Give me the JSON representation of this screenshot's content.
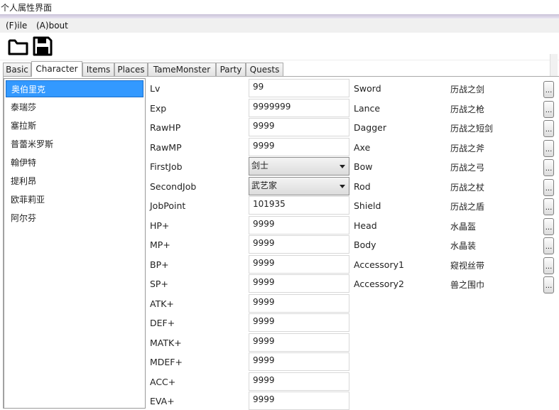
{
  "window": {
    "title": "个人属性界面"
  },
  "menu": {
    "file": "(F)ile",
    "about": "(A)bout"
  },
  "toolbar": {
    "open_icon": "folder-open-icon",
    "save_icon": "floppy-save-icon"
  },
  "tabs": [
    {
      "label": "Basic"
    },
    {
      "label": "Character"
    },
    {
      "label": "Items"
    },
    {
      "label": "Places"
    },
    {
      "label": "TameMonster"
    },
    {
      "label": "Party"
    },
    {
      "label": "Quests"
    }
  ],
  "active_tab": "Character",
  "characters": [
    {
      "name": "奥伯里克"
    },
    {
      "name": "泰瑞莎"
    },
    {
      "name": "塞拉斯"
    },
    {
      "name": "普蕾米罗斯"
    },
    {
      "name": "翰伊特"
    },
    {
      "name": "提利昂"
    },
    {
      "name": "欧菲莉亚"
    },
    {
      "name": "阿尔芬"
    }
  ],
  "selected_character": "奥伯里克",
  "stats": [
    {
      "label": "Lv",
      "value": "99"
    },
    {
      "label": "Exp",
      "value": "9999999"
    },
    {
      "label": "RawHP",
      "value": "9999"
    },
    {
      "label": "RawMP",
      "value": "9999"
    },
    {
      "label": "FirstJob",
      "value": "剑士"
    },
    {
      "label": "SecondJob",
      "value": "武艺家"
    },
    {
      "label": "JobPoint",
      "value": "101935"
    },
    {
      "label": "HP+",
      "value": "9999"
    },
    {
      "label": "MP+",
      "value": "9999"
    },
    {
      "label": "BP+",
      "value": "9999"
    },
    {
      "label": "SP+",
      "value": "9999"
    },
    {
      "label": "ATK+",
      "value": "9999"
    },
    {
      "label": "DEF+",
      "value": "9999"
    },
    {
      "label": "MATK+",
      "value": "9999"
    },
    {
      "label": "MDEF+",
      "value": "9999"
    },
    {
      "label": "ACC+",
      "value": "9999"
    },
    {
      "label": "EVA+",
      "value": "9999"
    }
  ],
  "equipment": [
    {
      "label": "Sword",
      "value": "历战之剑"
    },
    {
      "label": "Lance",
      "value": "历战之枪"
    },
    {
      "label": "Dagger",
      "value": "历战之短剑"
    },
    {
      "label": "Axe",
      "value": "历战之斧"
    },
    {
      "label": "Bow",
      "value": "历战之弓"
    },
    {
      "label": "Rod",
      "value": "历战之杖"
    },
    {
      "label": "Shield",
      "value": "历战之盾"
    },
    {
      "label": "Head",
      "value": "水晶盔"
    },
    {
      "label": "Body",
      "value": "水晶装"
    },
    {
      "label": "Accessory1",
      "value": "窥视丝带"
    },
    {
      "label": "Accessory2",
      "value": "兽之围巾"
    }
  ],
  "browse_button_label": "..."
}
